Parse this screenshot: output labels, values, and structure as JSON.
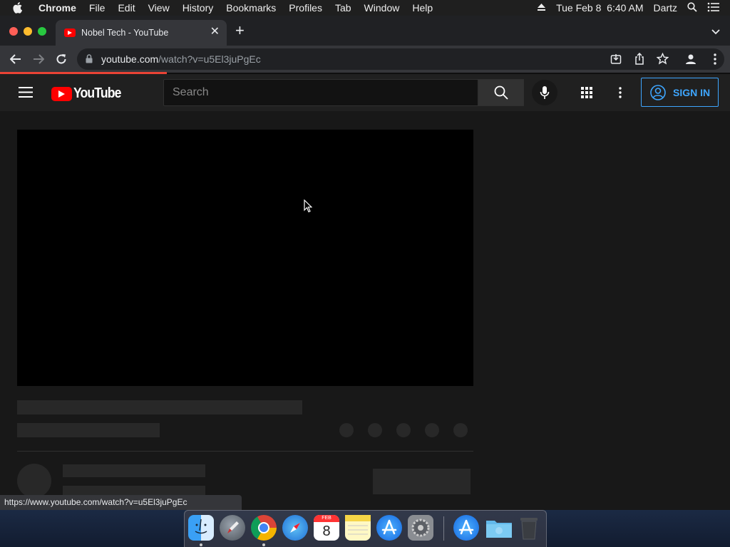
{
  "menubar": {
    "app": "Chrome",
    "items": [
      "File",
      "Edit",
      "View",
      "History",
      "Bookmarks",
      "Profiles",
      "Tab",
      "Window",
      "Help"
    ],
    "datetime": "Tue Feb 8  6:40 AM",
    "user": "Dartz"
  },
  "browser": {
    "tab_title": "Nobel Tech - YouTube",
    "url_host": "youtube.com",
    "url_path": "/watch?v=u5El3juPgEc",
    "status_url": "https://www.youtube.com/watch?v=u5El3juPgEc"
  },
  "youtube": {
    "logo_text": "YouTube",
    "search_placeholder": "Search",
    "signin_label": "SIGN IN"
  },
  "dock": {
    "calendar_month": "FEB",
    "calendar_day": "8"
  },
  "colors": {
    "accent_blue": "#3ea6ff",
    "youtube_red": "#ff0000",
    "loading_bar": "#ea4335"
  }
}
